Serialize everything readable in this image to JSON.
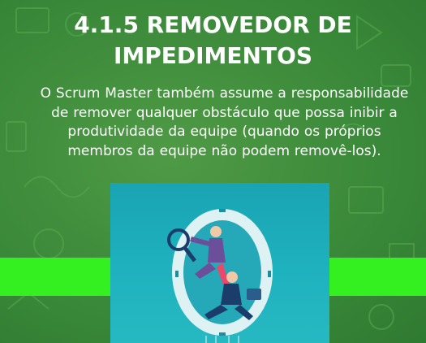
{
  "slide": {
    "title_lines": [
      "4.1.5 REMOVEDOR DE",
      "IMPEDIMENTOS"
    ],
    "body_lines": [
      "O Scrum Master também assume a responsabilidade",
      "de remover qualquer obstáculo que possa inibir a",
      "produtividade da equipe (quando os próprios",
      "membros da equipe não podem removê-los)."
    ],
    "illustration": "people-in-ring-icon"
  },
  "colors": {
    "background": "#3b8a3a",
    "band": "#35f021",
    "picture_background": "#1fb3bf",
    "text": "#ffffff"
  }
}
